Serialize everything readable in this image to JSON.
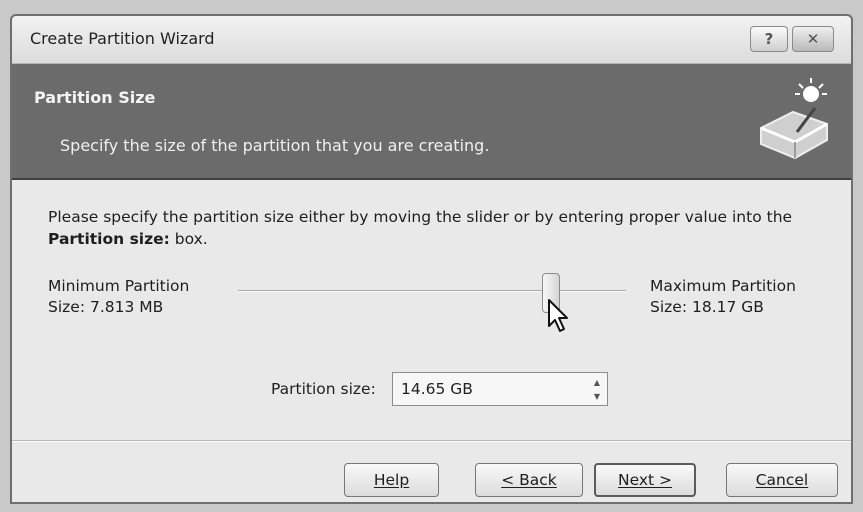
{
  "window": {
    "title": "Create Partition Wizard",
    "help_icon": "question-icon",
    "close_icon": "close-icon",
    "help_glyph": "?",
    "close_glyph": "✕"
  },
  "banner": {
    "title": "Partition Size",
    "subtitle": "Specify the size of the partition that you are creating.",
    "icon": "disk-wizard-icon"
  },
  "content": {
    "instruction_part1": "Please specify the partition size either by moving the slider or by entering proper value into the ",
    "instruction_bold": "Partition size:",
    "instruction_part2": " box.",
    "min_line1": "Minimum Partition",
    "min_line2": "Size: 7.813 MB",
    "max_line1": "Maximum Partition",
    "max_line2": "Size: 18.17 GB",
    "slider_fraction": 0.806,
    "size_label": "Partition size:",
    "size_value": "14.65 GB",
    "spin_up": "▲",
    "spin_down": "▼"
  },
  "buttons": {
    "help": "Help",
    "back": "< Back",
    "next": "Next >",
    "cancel": "Cancel"
  }
}
